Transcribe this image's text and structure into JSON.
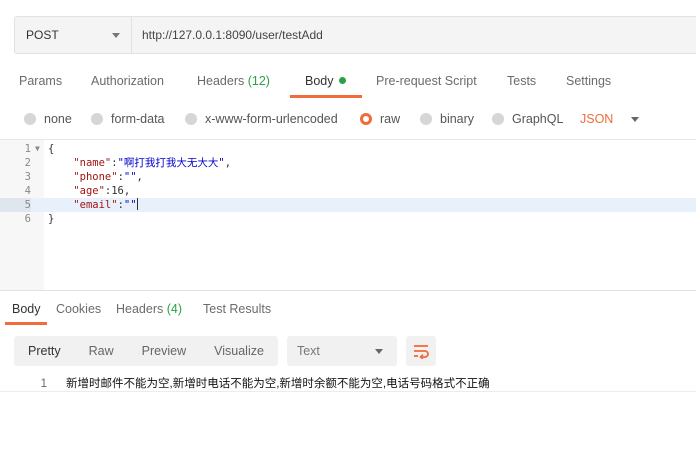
{
  "request": {
    "method": "POST",
    "url": "http://127.0.0.1:8090/user/testAdd"
  },
  "request_tabs": {
    "params": "Params",
    "authorization": "Authorization",
    "headers": "Headers",
    "headers_count": "(12)",
    "body": "Body",
    "prerequest": "Pre-request Script",
    "tests": "Tests",
    "settings": "Settings"
  },
  "body_types": {
    "none": "none",
    "form_data": "form-data",
    "urlencoded": "x-www-form-urlencoded",
    "raw": "raw",
    "binary": "binary",
    "graphql": "GraphQL",
    "format": "JSON",
    "selected": "raw"
  },
  "editor": {
    "line_numbers": [
      "1",
      "2",
      "3",
      "4",
      "5",
      "6"
    ],
    "open_brace": "{",
    "close_brace": "}",
    "fields": [
      {
        "key": "\"name\"",
        "value": "\"啊打我打我大无大大\"",
        "sep": ","
      },
      {
        "key": "\"phone\"",
        "value": "\"\"",
        "sep": ","
      },
      {
        "key": "\"age\"",
        "value": "16",
        "sep": ","
      },
      {
        "key": "\"email\"",
        "value": "\"\"",
        "sep": ""
      }
    ],
    "cursor_line": 5
  },
  "response_tabs": {
    "body": "Body",
    "cookies": "Cookies",
    "headers": "Headers",
    "headers_count": "(4)",
    "test_results": "Test Results"
  },
  "view_modes": {
    "pretty": "Pretty",
    "raw": "Raw",
    "preview": "Preview",
    "visualize": "Visualize",
    "language": "Text"
  },
  "response": {
    "line_number": "1",
    "text": "新增时邮件不能为空,新增时电话不能为空,新增时余额不能为空,电话号码格式不正确"
  },
  "colors": {
    "accent": "#f26b3a",
    "green": "#2aa145"
  },
  "icons": {
    "method_dropdown": "chevron-down-icon",
    "body_indicator": "dot-icon",
    "wrap": "wrap-lines-icon"
  }
}
